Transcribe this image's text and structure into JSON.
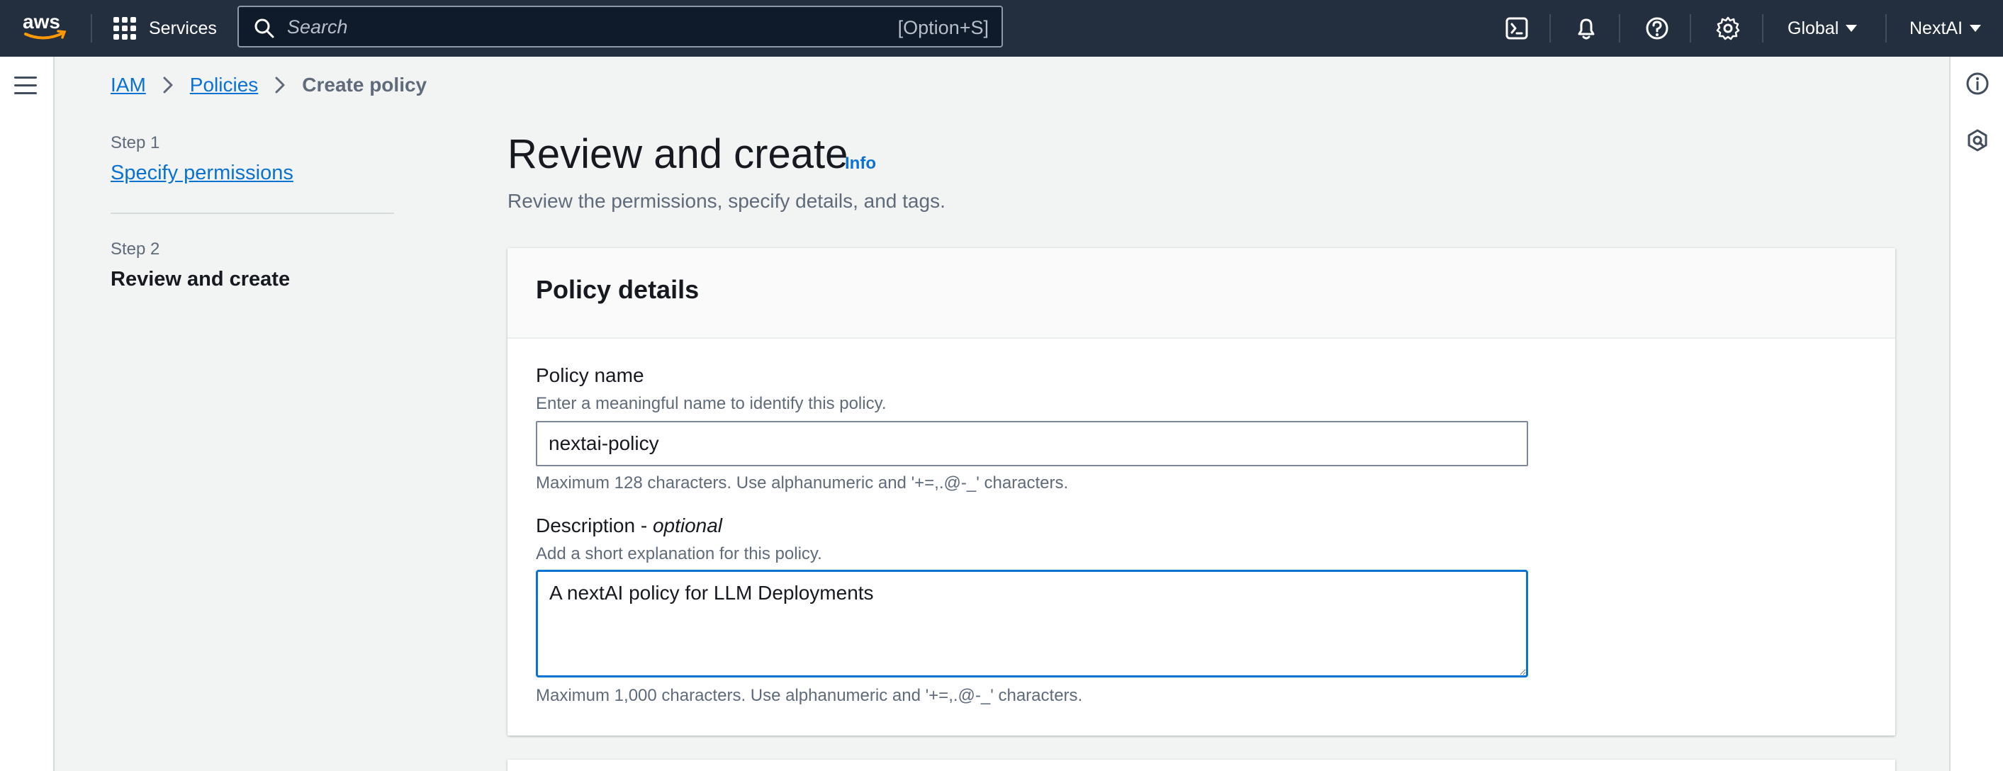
{
  "topnav": {
    "logo_text": "aws",
    "services_label": "Services",
    "search_placeholder": "Search",
    "search_shortcut": "[Option+S]",
    "region_label": "Global",
    "account_label": "NextAI",
    "icons": [
      "cloudshell-icon",
      "notifications-icon",
      "help-icon",
      "settings-icon"
    ]
  },
  "breadcrumb": {
    "items": [
      {
        "label": "IAM"
      },
      {
        "label": "Policies"
      },
      {
        "label": "Create policy"
      }
    ]
  },
  "steps": [
    {
      "step_label": "Step 1",
      "title": "Specify permissions"
    },
    {
      "step_label": "Step 2",
      "title": "Review and create"
    }
  ],
  "page": {
    "title": "Review and create",
    "info_label": "Info",
    "description": "Review the permissions, specify details, and tags."
  },
  "policy_details": {
    "header": "Policy details",
    "name": {
      "label": "Policy name",
      "description": "Enter a meaningful name to identify this policy.",
      "value": "nextai-policy",
      "constraint": "Maximum 128 characters. Use alphanumeric and '+=,.@-_' characters."
    },
    "description_field": {
      "label": "Description - ",
      "label_optional": "optional",
      "description": "Add a short explanation for this policy.",
      "value": "A nextAI policy for LLM Deployments",
      "constraint": "Maximum 1,000 characters. Use alphanumeric and '+=,.@-_' characters."
    }
  },
  "colors": {
    "nav_bg": "#232f3e",
    "link": "#0972d3",
    "page_bg": "#f2f3f3"
  }
}
